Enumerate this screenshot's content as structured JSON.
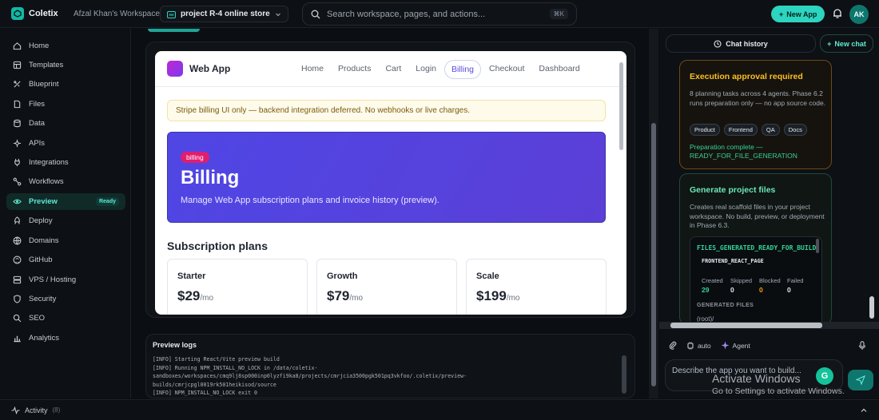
{
  "topbar": {
    "brand": "Coletix",
    "workspace": "Afzal Khan's Workspace",
    "project": "project R-4 online store",
    "search_placeholder": "Search workspace, pages, and actions...",
    "shortcut": "⌘K",
    "new_app": "New App",
    "avatar": "AK",
    "accent": "#2dd4bf"
  },
  "sidebar": {
    "items": [
      {
        "label": "Home",
        "icon": "home-icon"
      },
      {
        "label": "Templates",
        "icon": "templates-icon"
      },
      {
        "label": "Blueprint",
        "icon": "blueprint-icon"
      },
      {
        "label": "Files",
        "icon": "files-icon"
      },
      {
        "label": "Data",
        "icon": "database-icon"
      },
      {
        "label": "APIs",
        "icon": "api-icon"
      },
      {
        "label": "Integrations",
        "icon": "plug-icon"
      },
      {
        "label": "Workflows",
        "icon": "workflow-icon"
      },
      {
        "label": "Preview",
        "icon": "eye-icon",
        "badge": "Ready"
      },
      {
        "label": "Deploy",
        "icon": "rocket-icon"
      },
      {
        "label": "Domains",
        "icon": "globe-icon"
      },
      {
        "label": "GitHub",
        "icon": "github-icon"
      },
      {
        "label": "VPS / Hosting",
        "icon": "server-icon"
      },
      {
        "label": "Security",
        "icon": "shield-icon"
      },
      {
        "label": "SEO",
        "icon": "seo-icon"
      },
      {
        "label": "Analytics",
        "icon": "analytics-icon"
      }
    ]
  },
  "activity": {
    "label": "Activity",
    "count": "(8)"
  },
  "webapp": {
    "name": "Web App",
    "nav": [
      "Home",
      "Products",
      "Cart",
      "Login",
      "Billing",
      "Checkout",
      "Dashboard"
    ],
    "selected_nav": "Billing",
    "notice": "Stripe billing UI only — backend integration deferred. No webhooks or live charges.",
    "hero": {
      "pill": "billing",
      "title": "Billing",
      "subtitle": "Manage Web App subscription plans and invoice history (preview)."
    },
    "plans_title": "Subscription plans",
    "plans": [
      {
        "name": "Starter",
        "price": "$29",
        "period": "/mo"
      },
      {
        "name": "Growth",
        "price": "$79",
        "period": "/mo"
      },
      {
        "name": "Scale",
        "price": "$199",
        "period": "/mo"
      }
    ]
  },
  "logs": {
    "title": "Preview logs",
    "lines": [
      "[INFO] Starting React/Vite preview build",
      "[INFO] Running NPM_INSTALL_NO_LOCK in /data/coletix-",
      "sandboxes/workspaces/cmq9lj8sp000inp0lyzfi9ka8/projects/cmrjcia3500pgk501pq3vkfoo/.coletix/preview-",
      "builds/cmrjcpgl0019rk501heikisod/source",
      "[INFO] NPM_INSTALL_NO_LOCK exit 0"
    ]
  },
  "right": {
    "chat_history": "Chat history",
    "new_chat": "New chat",
    "approval": {
      "title": "Execution approval required",
      "body": "8 planning tasks across 4 agents. Phase 6.2 runs preparation only — no app source code.",
      "tags": [
        "Product",
        "Frontend",
        "QA",
        "Docs"
      ],
      "status": "Preparation complete — READY_FOR_FILE_GENERATION"
    },
    "generate": {
      "title": "Generate project files",
      "body": "Creates real scaffold files in your project workspace. No build, preview, or deployment in Phase 6.3.",
      "terminal_title": "FILES_GENERATED_READY_FOR_BUILD",
      "terminal_sub": "FRONTEND_REACT_PAGE",
      "stats": [
        {
          "label": "Created",
          "value": "29",
          "color": "#34d399"
        },
        {
          "label": "Skipped",
          "value": "0",
          "color": "#e6e9ee"
        },
        {
          "label": "Blocked",
          "value": "0",
          "color": "#f59e0b"
        },
        {
          "label": "Failed",
          "value": "0",
          "color": "#e6e9ee"
        }
      ],
      "files_label": "GENERATED FILES",
      "root": "(root)/"
    },
    "tools": {
      "auto": "auto",
      "agent": "Agent"
    },
    "input_placeholder": "Describe the app you want to build...",
    "grammarly": "G"
  },
  "watermark": {
    "line1": "Activate Windows",
    "line2": "Go to Settings to activate Windows."
  }
}
